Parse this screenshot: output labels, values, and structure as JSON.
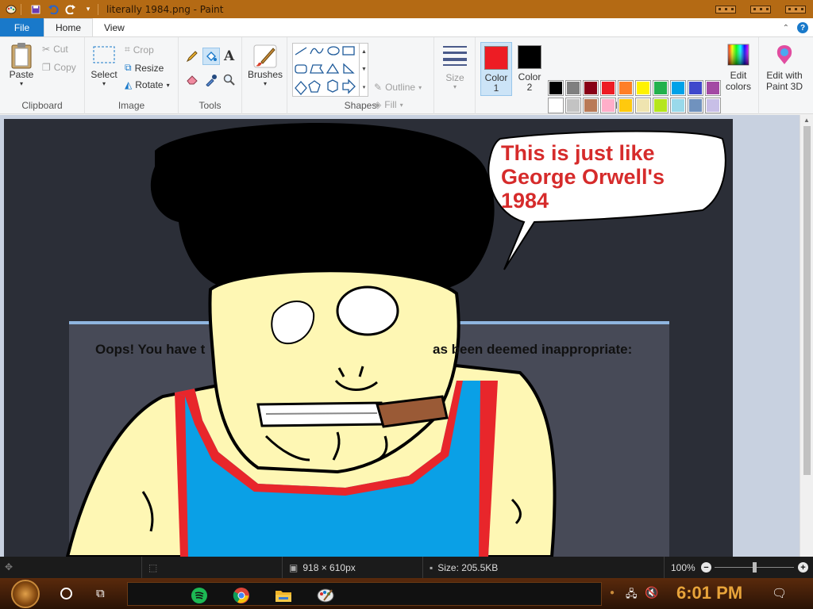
{
  "window": {
    "title": "literally 1984.png - Paint"
  },
  "tabs": {
    "file": "File",
    "home": "Home",
    "view": "View"
  },
  "ribbon": {
    "clipboard": {
      "label": "Clipboard",
      "paste": "Paste",
      "cut": "Cut",
      "copy": "Copy"
    },
    "image": {
      "label": "Image",
      "select": "Select",
      "crop": "Crop",
      "resize": "Resize",
      "rotate": "Rotate"
    },
    "tools": {
      "label": "Tools"
    },
    "brushes": {
      "label": "Brushes"
    },
    "shapes": {
      "label": "Shapes",
      "outline": "Outline",
      "fill": "Fill"
    },
    "size": {
      "label": "Size"
    },
    "colors": {
      "label": "Colors",
      "color1_line1": "Color",
      "color1_line2": "1",
      "color2_line1": "Color",
      "color2_line2": "2",
      "color1_value": "#ed1c24",
      "color2_value": "#000000",
      "edit_line1": "Edit",
      "edit_line2": "colors",
      "paint3d_line1": "Edit with",
      "paint3d_line2": "Paint 3D",
      "palette": [
        "#000000",
        "#7f7f7f",
        "#880015",
        "#ed1c24",
        "#ff7f27",
        "#fff200",
        "#22b14c",
        "#00a2e8",
        "#3f48cc",
        "#a349a4",
        "#ffffff",
        "#c3c3c3",
        "#b97a57",
        "#ffaec9",
        "#ffc90e",
        "#efe4b0",
        "#b5e61d",
        "#99d9ea",
        "#7092be",
        "#c8bfe7",
        "#ffffff",
        "#ffffff",
        "#ffffff",
        "#ffffff",
        "#ffffff",
        "#ffffff",
        "#ffffff",
        "#ffffff",
        "#ffffff",
        "#ffffff"
      ]
    }
  },
  "canvas": {
    "bubble_line1": "This is just like",
    "bubble_line2": "George Orwell's",
    "bubble_line3": "1984",
    "dialog_text_left": "Oops! You have t",
    "dialog_text_right": "as been deemed inappropriate:"
  },
  "statusbar": {
    "dimensions": "918 × 610px",
    "size": "Size: 205.5KB",
    "zoom": "100%"
  },
  "taskbar": {
    "time": "6:01 PM"
  }
}
